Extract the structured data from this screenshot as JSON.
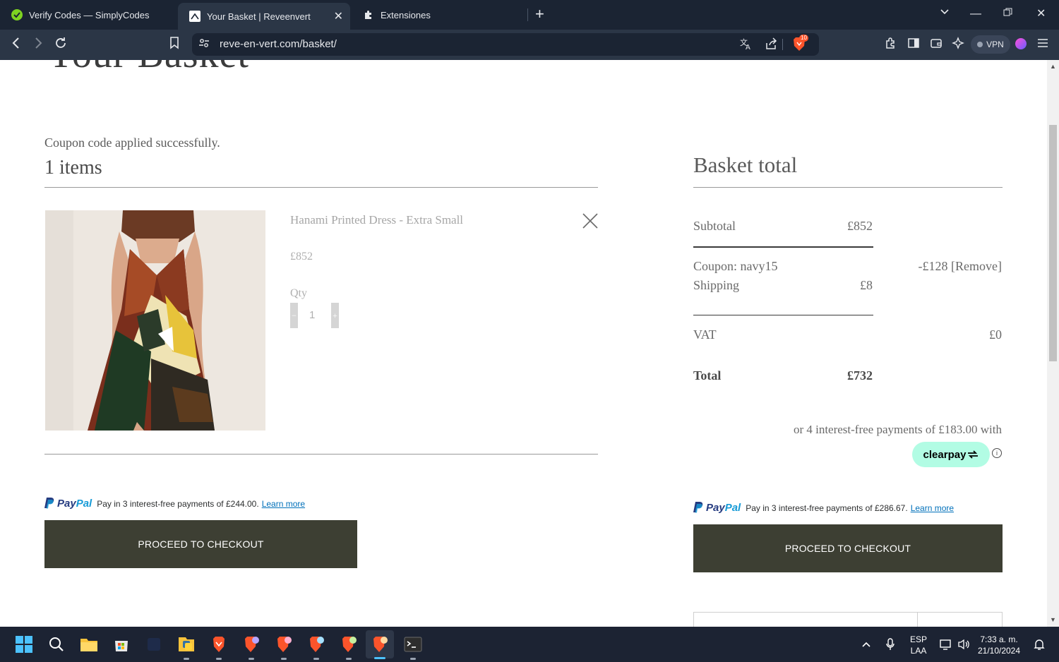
{
  "browser": {
    "tabs": [
      {
        "title": "Verify Codes — SimplyCodes",
        "active": false
      },
      {
        "title": "Your Basket | Reveenvert",
        "active": true
      },
      {
        "title": "Extensiones",
        "active": false
      }
    ],
    "url": "reve-en-vert.com/basket/",
    "shield_count": "10",
    "vpn_label": "VPN"
  },
  "page": {
    "heading": "Your Basket",
    "coupon_message": "Coupon code applied successfully.",
    "items_count": "1 items",
    "item": {
      "name": "Hanami Printed Dress - Extra Small",
      "price": "£852",
      "qty_label": "Qty",
      "qty_value": "1",
      "minus": "−",
      "plus": "+"
    },
    "left_paypal": {
      "pay": "Pay",
      "pal": "Pal",
      "message": "Pay in 3 interest-free payments of £244.00.",
      "learn_more": "Learn more"
    },
    "left_checkout": "PROCEED TO CHECKOUT",
    "summary": {
      "title": "Basket total",
      "subtotal_label": "Subtotal",
      "subtotal_value": "£852",
      "coupon_label": "Coupon: navy15",
      "coupon_value": "-£128 [Remove]",
      "shipping_label": "Shipping",
      "shipping_value": "£8",
      "vat_label": "VAT",
      "vat_value": "£0",
      "total_label": "Total",
      "total_value": "£732",
      "installments": "or 4 interest-free payments of £183.00 with",
      "clearpay": "clearpay",
      "info": "i"
    },
    "right_paypal": {
      "pay": "Pay",
      "pal": "Pal",
      "message": "Pay in 3 interest-free payments of £286.67.",
      "learn_more": "Learn more"
    },
    "right_checkout": "PROCEED TO CHECKOUT"
  },
  "taskbar": {
    "language": [
      "ESP",
      "LAA"
    ],
    "time": "7:33 a. m.",
    "date": "21/10/2024"
  },
  "colors": {
    "chrome_dark": "#1b2433",
    "chrome_toolbar": "#2b3646",
    "checkout_bg": "#3d3f33",
    "clearpay_mint": "#b2fce4",
    "paypal_blue": "#253b80",
    "paypal_light": "#179bd7"
  }
}
